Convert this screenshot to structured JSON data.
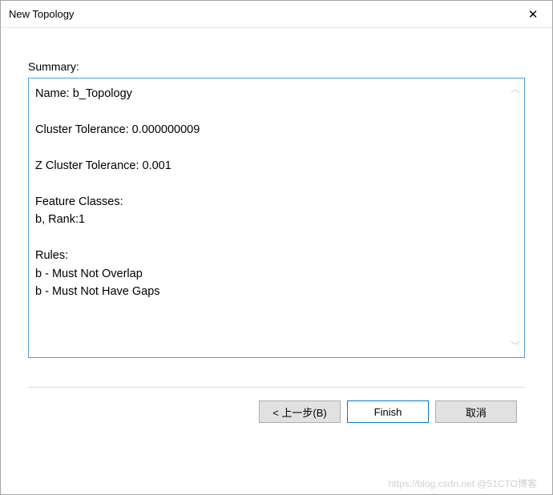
{
  "window": {
    "title": "New Topology"
  },
  "labels": {
    "summary": "Summary:"
  },
  "summary": {
    "line_name": "Name: b_Topology",
    "line_ctol": "Cluster Tolerance: 0.000000009",
    "line_ztol": "Z Cluster Tolerance: 0.001",
    "line_fc_header": "Feature Classes:",
    "line_fc_item": "b, Rank:1",
    "line_rules_header": "Rules:",
    "line_rule1": "b - Must Not Overlap",
    "line_rule2": "b - Must Not Have Gaps"
  },
  "buttons": {
    "back": "< 上一步(B)",
    "finish": "Finish",
    "cancel": "取消"
  },
  "watermark": "https://blog.csdn.net @51CTO博客"
}
